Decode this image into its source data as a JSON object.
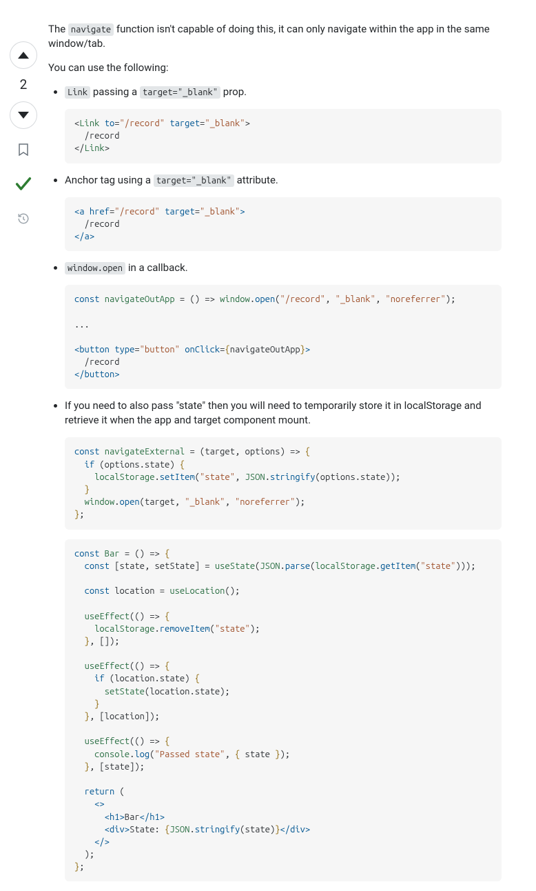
{
  "vote": {
    "count": "2"
  },
  "para1": {
    "pre": "The ",
    "code": "navigate",
    "post": " function isn't capable of doing this, it can only navigate within the app in the same window/tab."
  },
  "para2": "You can use the following:",
  "bullets": {
    "b1": {
      "code": "Link",
      "mid": " passing a ",
      "code2": "target=\"_blank\"",
      "post": " prop."
    },
    "b2": {
      "pre": "Anchor tag using a ",
      "code": "target=\"_blank\"",
      "post": " attribute."
    },
    "b3": {
      "code": "window.open",
      "post": " in a callback."
    },
    "b4": "If you need to also pass \"state\" then you will need to temporarily store it in localStorage and retrieve it when the app and target component mount."
  }
}
